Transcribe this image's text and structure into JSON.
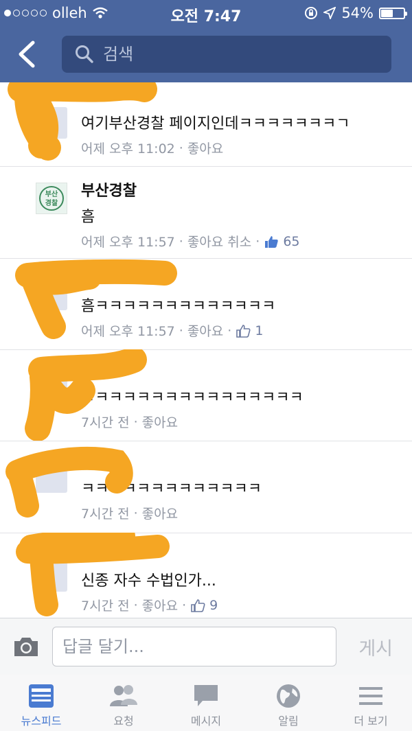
{
  "status_bar": {
    "carrier": "olleh",
    "time": "오전 7:47",
    "battery": "54%",
    "battery_level": 0.54,
    "signal_bars": 1
  },
  "header": {
    "search_placeholder": "검색",
    "bg_color": "#4a669f"
  },
  "comments": [
    {
      "name": "",
      "text": "여기부산경찰 페이지인데ㅋㅋㅋㅋㅋㅋㅋㄱ",
      "time": "어제 오후 11:02",
      "like_label": "좋아요",
      "likes": ""
    },
    {
      "name": "부산경찰",
      "text": "흠",
      "time": "어제 오후 11:57",
      "like_label": "좋아요 취소",
      "likes": "65",
      "avatar_text": "부산\n경찰"
    },
    {
      "name": "",
      "text": "흠ㅋㅋㅋㅋㅋㅋㅋㅋㅋㅋㅋㅋㅋ",
      "time": "어제 오후 11:57",
      "like_label": "좋아요",
      "likes": "1"
    },
    {
      "name": "",
      "text": "ㅋㅋㅋㅋㅋㅋㅋㅋㅋㅋㅋㅋㅋㅋㅋㅋ",
      "time": "7시간 전",
      "like_label": "좋아요",
      "likes": ""
    },
    {
      "name": "",
      "text": "ㅋㅋㅋㅋㅋㅋㅋㅋㅋㅋㅋㅋㅋ",
      "time": "7시간 전",
      "like_label": "좋아요",
      "likes": ""
    },
    {
      "name": "",
      "text": "신종 자수 수법인가...",
      "time": "7시간 전",
      "like_label": "좋아요",
      "likes": "9"
    }
  ],
  "composer": {
    "placeholder": "답글 달기...",
    "post_label": "게시"
  },
  "tabs": [
    {
      "label": "뉴스피드",
      "icon": "newsfeed-icon",
      "active": true
    },
    {
      "label": "요청",
      "icon": "friend-requests-icon",
      "active": false
    },
    {
      "label": "메시지",
      "icon": "messages-icon",
      "active": false
    },
    {
      "label": "알림",
      "icon": "globe-notifications-icon",
      "active": false
    },
    {
      "label": "더 보기",
      "icon": "menu-icon",
      "active": false
    }
  ],
  "colors": {
    "accent": "#4a7bd1",
    "redaction": "#f5a623",
    "meta_text": "#9197a3"
  }
}
